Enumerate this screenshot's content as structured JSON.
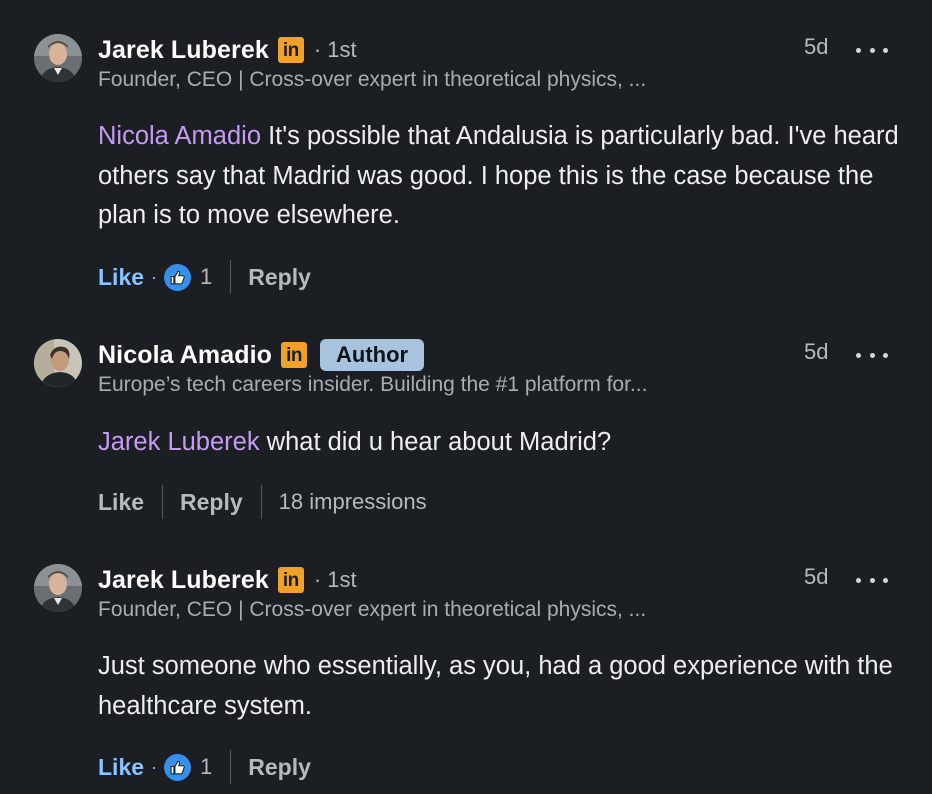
{
  "comments": [
    {
      "name": "Jarek Luberek",
      "linkedin_badge": "in",
      "degree": "· 1st",
      "headline": "Founder, CEO | Cross-over expert in theoretical physics, ...",
      "time": "5d",
      "mention": "Nicola Amadio",
      "text": " It's possible that Andalusia is particularly bad. I've heard others say that Madrid was good. I hope this is the case because the plan is to move elsewhere.",
      "like_label": "Like",
      "dot": "·",
      "reaction_count": "1",
      "reply_label": "Reply"
    },
    {
      "name": "Nicola Amadio",
      "linkedin_badge": "in",
      "author_badge": "Author",
      "headline": "Europe’s tech careers insider. Building the #1 platform for...",
      "time": "5d",
      "mention": "Jarek Luberek",
      "text": " what did u hear about Madrid?",
      "like_label": "Like",
      "reply_label": "Reply",
      "impressions": "18 impressions"
    },
    {
      "name": "Jarek Luberek",
      "linkedin_badge": "in",
      "degree": "· 1st",
      "headline": "Founder, CEO | Cross-over expert in theoretical physics, ...",
      "time": "5d",
      "text": "Just someone who essentially, as you, had a good experience with the healthcare system.",
      "like_label": "Like",
      "dot": "·",
      "reaction_count": "1",
      "reply_label": "Reply"
    }
  ],
  "colors": {
    "background": "#1b1f23",
    "mention": "#c79bf2",
    "like_active": "#8ac3ff",
    "linkedin_badge": "#f0a12a",
    "author_badge": "#a8c3de",
    "reaction": "#378fe9"
  }
}
